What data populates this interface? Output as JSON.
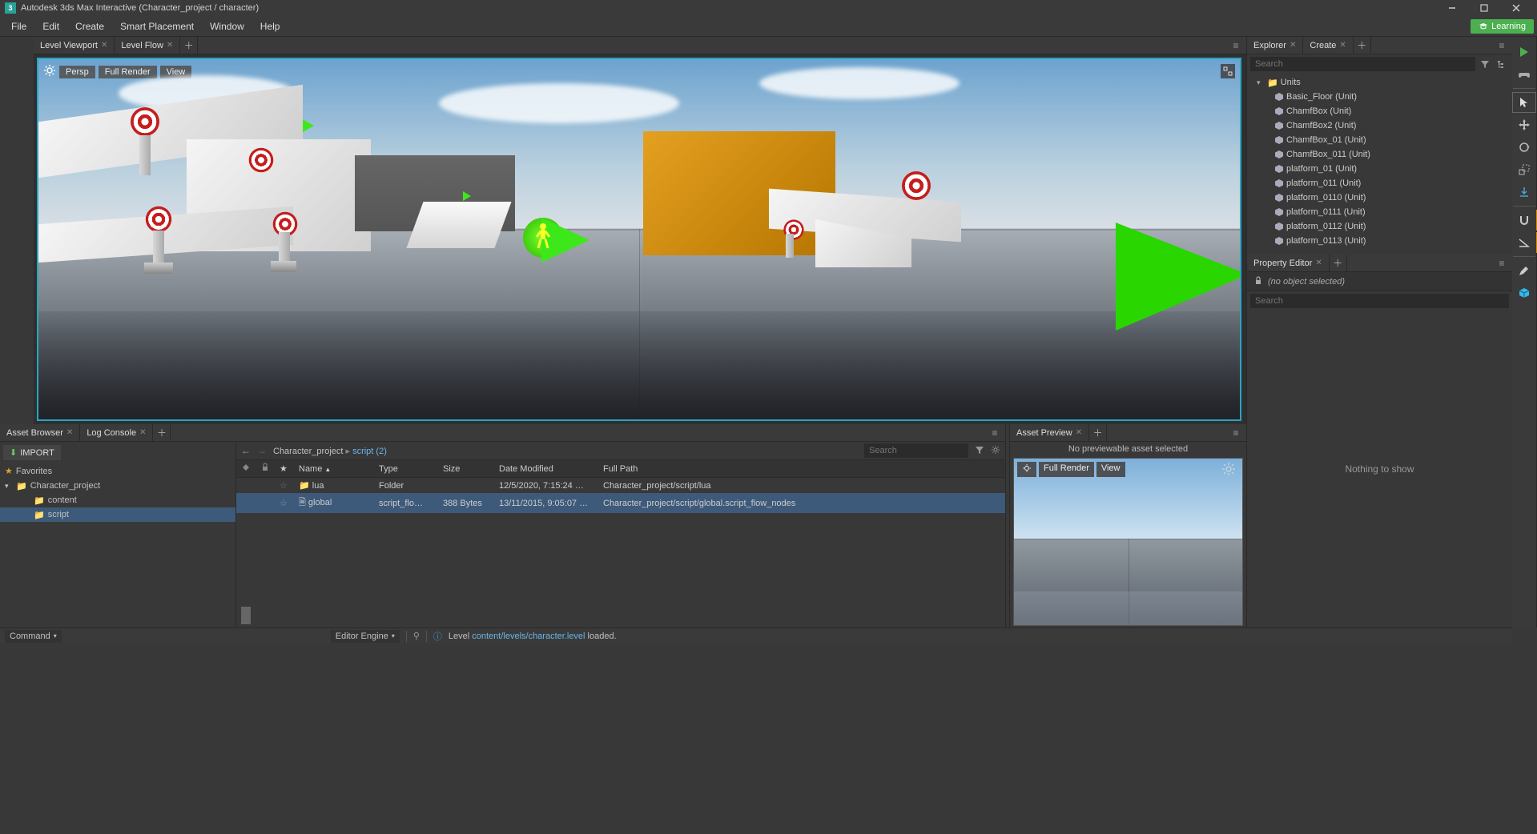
{
  "title": "Autodesk 3ds Max Interactive (Character_project / character)",
  "menu": {
    "items": [
      "File",
      "Edit",
      "Create",
      "Smart Placement",
      "Window",
      "Help"
    ],
    "learning": "Learning"
  },
  "center_tabs": {
    "items": [
      {
        "label": "Level Viewport"
      },
      {
        "label": "Level Flow"
      }
    ]
  },
  "viewport_toolbar": {
    "persp": "Persp",
    "render_mode": "Full Render",
    "view": "View"
  },
  "explorer": {
    "tab": "Explorer",
    "tab2": "Create",
    "search_placeholder": "Search",
    "root": "Units",
    "items": [
      "Basic_Floor (Unit)",
      "ChamfBox (Unit)",
      "ChamfBox2 (Unit)",
      "ChamfBox_01 (Unit)",
      "ChamfBox_011 (Unit)",
      "platform_01 (Unit)",
      "platform_011 (Unit)",
      "platform_0110 (Unit)",
      "platform_0111 (Unit)",
      "platform_0112 (Unit)",
      "platform_0113 (Unit)"
    ]
  },
  "property_editor": {
    "tab": "Property Editor",
    "no_selection": "(no object selected)",
    "search_placeholder": "Search",
    "empty": "Nothing to show"
  },
  "bottom_tabs": {
    "asset_browser": "Asset Browser",
    "log_console": "Log Console"
  },
  "asset_browser": {
    "import_btn": "IMPORT",
    "favorites": "Favorites",
    "project_tree": {
      "root": "Character_project",
      "children": [
        "content",
        "script"
      ],
      "selected": "script"
    },
    "breadcrumb": {
      "root": "Character_project",
      "current": "script (2)"
    },
    "search_placeholder": "Search",
    "columns": [
      "Name",
      "Type",
      "Size",
      "Date Modified",
      "Full Path"
    ],
    "rows": [
      {
        "name": "lua",
        "type": "Folder",
        "size": "",
        "date": "12/5/2020, 7:15:24 …",
        "path": "Character_project/script/lua",
        "icon": "folder"
      },
      {
        "name": "global",
        "type": "script_flo…",
        "size": "388 Bytes",
        "date": "13/11/2015, 9:05:07 …",
        "path": "Character_project/script/global.script_flow_nodes",
        "icon": "file",
        "selected": true
      }
    ]
  },
  "asset_preview": {
    "tab": "Asset Preview",
    "empty_msg": "No previewable asset selected",
    "render": "Full Render",
    "view": "View"
  },
  "statusbar": {
    "command": "Command",
    "engine": "Editor Engine",
    "msg_prefix": "Level ",
    "msg_link": "content/levels/character.level",
    "msg_suffix": " loaded."
  }
}
